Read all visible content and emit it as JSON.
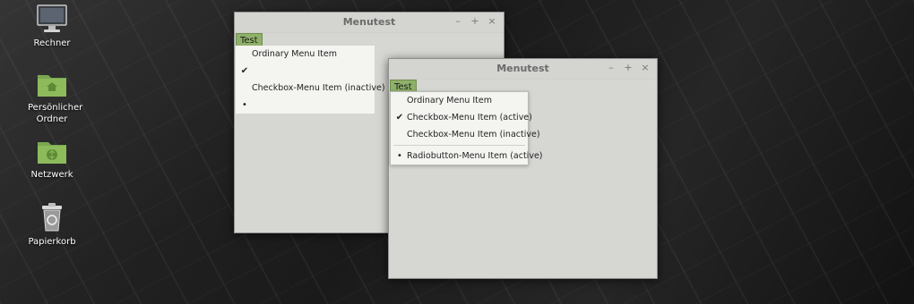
{
  "desktop": {
    "icons": [
      {
        "label": "Rechner",
        "icon": "monitor-icon"
      },
      {
        "label": "Persönlicher Ordner",
        "icon": "home-folder-icon"
      },
      {
        "label": "Netzwerk",
        "icon": "network-folder-icon"
      },
      {
        "label": "Papierkorb",
        "icon": "trash-icon"
      }
    ]
  },
  "window1": {
    "title": "Menutest",
    "controls": {
      "minimize": "–",
      "maximize": "+",
      "close": "×"
    },
    "menu_label": "Test",
    "items": [
      {
        "label": "Ordinary Menu Item",
        "mark": ""
      },
      {
        "label": "",
        "mark": "✔"
      },
      {
        "label": "Checkbox-Menu Item (inactive)",
        "mark": ""
      },
      {
        "label": "",
        "mark": "•"
      }
    ]
  },
  "window2": {
    "title": "Menutest",
    "controls": {
      "minimize": "–",
      "maximize": "+",
      "close": "×"
    },
    "menu_label": "Test",
    "items": [
      {
        "label": "Ordinary Menu Item",
        "mark": ""
      },
      {
        "label": "Checkbox-Menu Item (active)",
        "mark": "✔"
      },
      {
        "label": "Checkbox-Menu Item (inactive)",
        "mark": ""
      },
      {
        "label": "Radiobutton-Menu Item (active)",
        "mark": "•"
      }
    ]
  },
  "colors": {
    "accent": "#8fb06a",
    "window_bg": "#d6d7d3",
    "menu_bg": "#f4f5f1"
  }
}
